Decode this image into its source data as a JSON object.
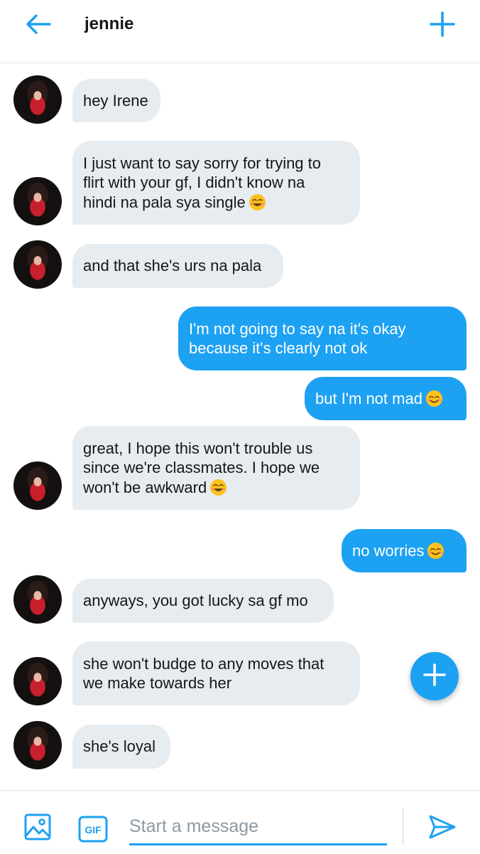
{
  "header": {
    "title": "jennie",
    "back_icon": "arrow-left-icon",
    "new_icon": "plus-icon",
    "accent": "#1da1f2"
  },
  "messages": [
    {
      "direction": "in",
      "text": "hey Irene",
      "emoji": false
    },
    {
      "direction": "in",
      "text": "I just want to say sorry for trying to\nflirt with your gf, I didn't know na\nhindi na pala sya single",
      "emoji": true
    },
    {
      "direction": "in",
      "text": "and that she's urs na pala",
      "emoji": false
    },
    {
      "direction": "out",
      "text": "I'm not going to say na it's okay\nbecause it's clearly not ok",
      "emoji": false
    },
    {
      "direction": "out",
      "text": "but I'm not mad",
      "emoji": true
    },
    {
      "direction": "in",
      "text": "great, I hope this won't trouble us\nsince we're classmates. I hope we\nwon't be awkward",
      "emoji": true
    },
    {
      "direction": "out",
      "text": "no worries",
      "emoji": true
    },
    {
      "direction": "in",
      "text": "anyways, you got lucky sa gf mo",
      "emoji": false
    },
    {
      "direction": "in",
      "text": "she won't budge to any moves that\nwe make towards her",
      "emoji": false
    },
    {
      "direction": "in",
      "text": "she's loyal",
      "emoji": false
    }
  ],
  "fab": {
    "icon": "plus-icon"
  },
  "composer": {
    "placeholder": "Start a message",
    "value": "",
    "gif_label": "GIF",
    "image_icon": "image-icon",
    "send_icon": "send-icon"
  },
  "colors": {
    "incoming_bubble": "#e6ecf0",
    "outgoing_bubble": "#1da1f2",
    "placeholder": "#8c9aa5"
  }
}
